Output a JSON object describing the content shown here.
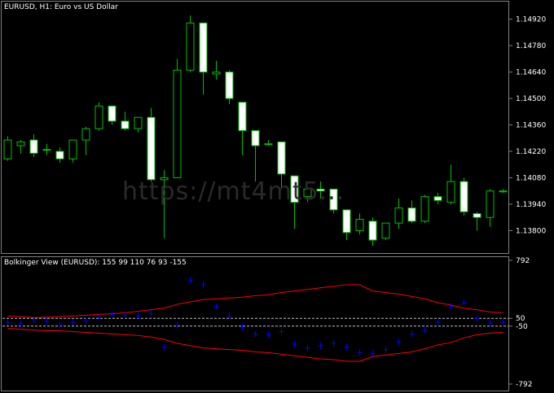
{
  "main_chart": {
    "title": "EURUSD, H1:  Euro vs US Dollar",
    "watermark": "https://mt4mt5...",
    "price_ticks": [
      "1.14920",
      "1.14780",
      "1.14640",
      "1.14500",
      "1.14360",
      "1.14220",
      "1.14080",
      "1.13940",
      "1.13800"
    ],
    "bull_color": "#00c000",
    "bear_color": "#ffffff"
  },
  "indicator": {
    "title": "Bolkinger View (EURUSD):   155 99 110 76 93 -155",
    "axis_ticks": [
      "792",
      "50",
      "-50",
      "-792"
    ],
    "band_color": "#ff0000",
    "line_color": "#0000ff",
    "level_color": "#c0c0c0"
  },
  "chart_data": [
    {
      "type": "candlestick",
      "title": "EURUSD, H1:  Euro vs US Dollar",
      "ylim": [
        1.1372,
        1.1497
      ],
      "yticks": [
        1.1492,
        1.1478,
        1.1464,
        1.145,
        1.1436,
        1.1422,
        1.1408,
        1.1394,
        1.138
      ],
      "candles": [
        {
          "o": 1.1418,
          "h": 1.143,
          "l": 1.1417,
          "c": 1.1428
        },
        {
          "o": 1.1425,
          "h": 1.1428,
          "l": 1.1421,
          "c": 1.1427
        },
        {
          "o": 1.1428,
          "h": 1.1431,
          "l": 1.1419,
          "c": 1.1421
        },
        {
          "o": 1.1423,
          "h": 1.1426,
          "l": 1.142,
          "c": 1.1423
        },
        {
          "o": 1.1422,
          "h": 1.1424,
          "l": 1.1416,
          "c": 1.1418
        },
        {
          "o": 1.1418,
          "h": 1.1428,
          "l": 1.1416,
          "c": 1.1428
        },
        {
          "o": 1.1428,
          "h": 1.1435,
          "l": 1.142,
          "c": 1.1434
        },
        {
          "o": 1.1434,
          "h": 1.1448,
          "l": 1.1433,
          "c": 1.1446
        },
        {
          "o": 1.1446,
          "h": 1.1446,
          "l": 1.1436,
          "c": 1.1438
        },
        {
          "o": 1.1438,
          "h": 1.1443,
          "l": 1.1433,
          "c": 1.1434
        },
        {
          "o": 1.1434,
          "h": 1.144,
          "l": 1.1432,
          "c": 1.144
        },
        {
          "o": 1.144,
          "h": 1.1445,
          "l": 1.1406,
          "c": 1.1407
        },
        {
          "o": 1.1407,
          "h": 1.1412,
          "l": 1.1376,
          "c": 1.1408
        },
        {
          "o": 1.1408,
          "h": 1.1471,
          "l": 1.1408,
          "c": 1.1465
        },
        {
          "o": 1.1465,
          "h": 1.1494,
          "l": 1.1464,
          "c": 1.149
        },
        {
          "o": 1.149,
          "h": 1.149,
          "l": 1.1452,
          "c": 1.1464
        },
        {
          "o": 1.1463,
          "h": 1.147,
          "l": 1.146,
          "c": 1.1464
        },
        {
          "o": 1.1464,
          "h": 1.1465,
          "l": 1.1447,
          "c": 1.145
        },
        {
          "o": 1.1448,
          "h": 1.1448,
          "l": 1.142,
          "c": 1.1433
        },
        {
          "o": 1.1433,
          "h": 1.1433,
          "l": 1.1406,
          "c": 1.1425
        },
        {
          "o": 1.1426,
          "h": 1.1428,
          "l": 1.1425,
          "c": 1.1426
        },
        {
          "o": 1.1427,
          "h": 1.1427,
          "l": 1.1402,
          "c": 1.141
        },
        {
          "o": 1.1409,
          "h": 1.1409,
          "l": 1.1381,
          "c": 1.1395
        },
        {
          "o": 1.1398,
          "h": 1.1403,
          "l": 1.1395,
          "c": 1.1402
        },
        {
          "o": 1.1402,
          "h": 1.1406,
          "l": 1.1397,
          "c": 1.1401
        },
        {
          "o": 1.1402,
          "h": 1.1402,
          "l": 1.1389,
          "c": 1.1391
        },
        {
          "o": 1.1391,
          "h": 1.1391,
          "l": 1.1375,
          "c": 1.1379
        },
        {
          "o": 1.138,
          "h": 1.1389,
          "l": 1.1378,
          "c": 1.1386
        },
        {
          "o": 1.1385,
          "h": 1.1387,
          "l": 1.1372,
          "c": 1.1375
        },
        {
          "o": 1.1376,
          "h": 1.1384,
          "l": 1.1375,
          "c": 1.1384
        },
        {
          "o": 1.1384,
          "h": 1.1397,
          "l": 1.1381,
          "c": 1.1392
        },
        {
          "o": 1.1392,
          "h": 1.1396,
          "l": 1.1384,
          "c": 1.1385
        },
        {
          "o": 1.1385,
          "h": 1.1399,
          "l": 1.1384,
          "c": 1.1398
        },
        {
          "o": 1.1398,
          "h": 1.14,
          "l": 1.1394,
          "c": 1.1396
        },
        {
          "o": 1.1395,
          "h": 1.1415,
          "l": 1.1394,
          "c": 1.1406
        },
        {
          "o": 1.1406,
          "h": 1.1408,
          "l": 1.1388,
          "c": 1.139
        },
        {
          "o": 1.1389,
          "h": 1.139,
          "l": 1.138,
          "c": 1.1387
        },
        {
          "o": 1.1387,
          "h": 1.1402,
          "l": 1.1382,
          "c": 1.1401
        },
        {
          "o": 1.1401,
          "h": 1.1402,
          "l": 1.14,
          "c": 1.1401
        }
      ]
    },
    {
      "type": "line",
      "title": "Bolkinger View (EURUSD):   155 99 110 76 93 -155",
      "ylim": [
        -792,
        792
      ],
      "yticks": [
        792,
        50,
        -50,
        -792
      ],
      "levels": [
        50,
        -50
      ],
      "series": [
        {
          "values": [
            0,
            -20,
            30,
            10,
            -40,
            0,
            20,
            60,
            100,
            90,
            80,
            110,
            -320,
            -40,
            540,
            480,
            200,
            80,
            -60,
            -150,
            -160,
            -120,
            -280,
            -330,
            -300,
            -270,
            -320,
            -390,
            -400,
            -350,
            -250,
            -150,
            -100,
            0,
            200,
            250,
            50,
            -10,
            0
          ]
        },
        {
          "values": [
            80,
            70,
            60,
            65,
            70,
            80,
            90,
            100,
            110,
            120,
            140,
            160,
            180,
            230,
            260,
            290,
            300,
            310,
            320,
            340,
            350,
            380,
            400,
            420,
            440,
            460,
            480,
            480,
            400,
            380,
            360,
            330,
            300,
            250,
            220,
            180,
            160,
            130,
            120
          ]
        },
        {
          "values": [
            -80,
            -90,
            -100,
            -110,
            -110,
            -120,
            -130,
            -140,
            -150,
            -160,
            -170,
            -190,
            -220,
            -270,
            -300,
            -330,
            -340,
            -350,
            -360,
            -380,
            -390,
            -410,
            -430,
            -450,
            -470,
            -480,
            -500,
            -500,
            -440,
            -420,
            -400,
            -380,
            -340,
            -290,
            -260,
            -200,
            -160,
            -140,
            -130
          ]
        }
      ]
    }
  ]
}
